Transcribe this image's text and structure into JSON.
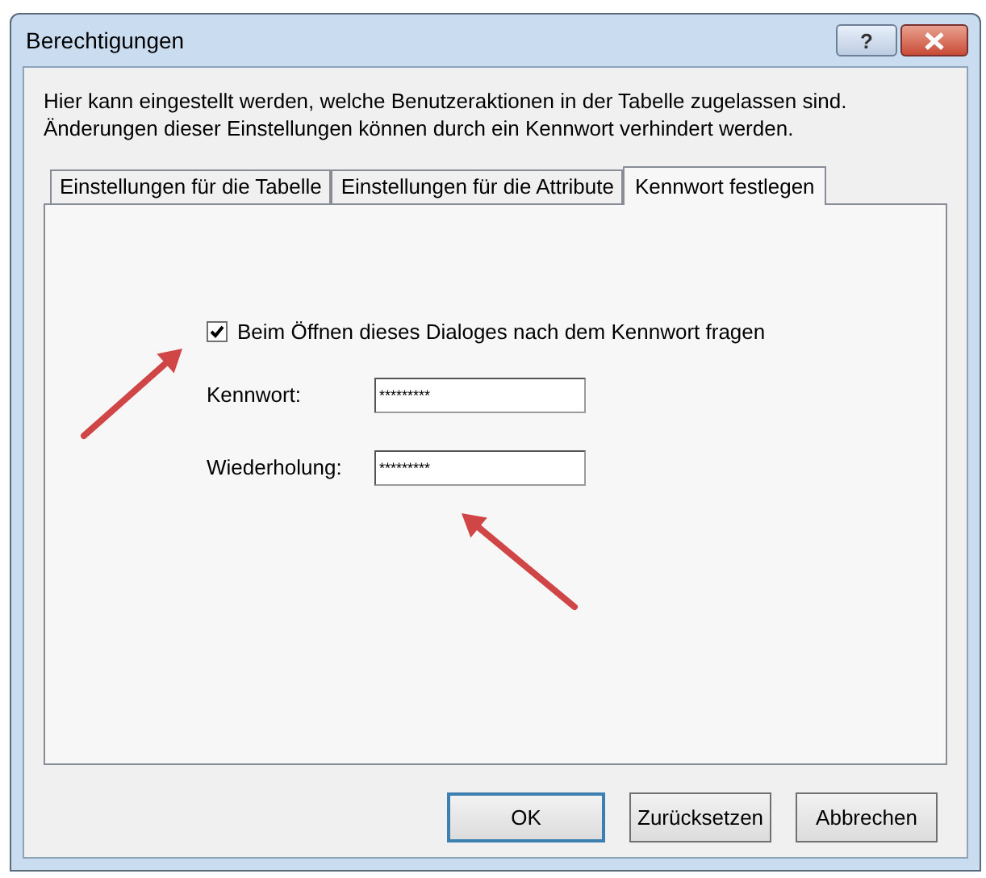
{
  "window": {
    "title": "Berechtigungen",
    "help_button": "?"
  },
  "description": [
    "Hier kann eingestellt werden, welche Benutzeraktionen in der Tabelle zugelassen sind.",
    "Änderungen dieser Einstellungen können durch ein Kennwort verhindert werden."
  ],
  "tabs": [
    {
      "label": "Einstellungen für die Tabelle",
      "selected": false
    },
    {
      "label": "Einstellungen für die Attribute",
      "selected": false
    },
    {
      "label": "Kennwort festlegen",
      "selected": true
    }
  ],
  "ask_password": {
    "label": "Beim Öffnen dieses Dialoges nach dem Kennwort fragen",
    "checked": true
  },
  "fields": [
    {
      "label": "Kennwort:",
      "value": "*********"
    },
    {
      "label": "Wiederholung:",
      "value": "*********"
    }
  ],
  "buttons": [
    {
      "label": "OK",
      "default": true
    },
    {
      "label": "Zurücksetzen",
      "default": false
    },
    {
      "label": "Abbrechen",
      "default": false
    }
  ]
}
